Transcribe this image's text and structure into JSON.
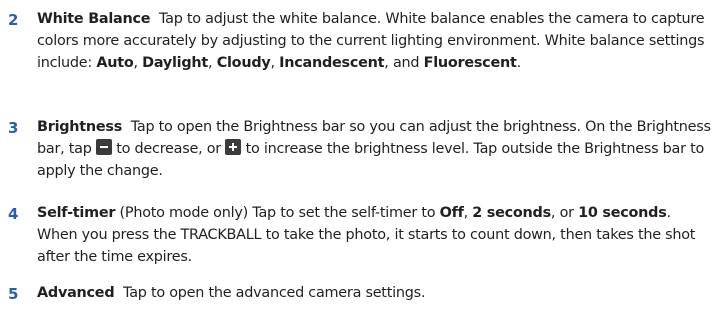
{
  "items": [
    {
      "number": "2",
      "title": "White Balance",
      "text_1": "Tap to adjust the white balance. White balance enables the camera to capture colors more accurately by adjusting to the current lighting environment. White balance settings include:",
      "opt_1": "Auto",
      "opt_2": "Daylight",
      "opt_3": "Cloudy",
      "opt_4": "Incandescent",
      "and": "and",
      "opt_5": "Fluorescent",
      "end": "."
    },
    {
      "number": "3",
      "title": "Brightness",
      "text_1": "Tap to open the Brightness bar so you can adjust the brightness. On the Brightness bar, tap",
      "minus_icon": "minus-icon",
      "text_2": "to decrease, or",
      "plus_icon": "plus-icon",
      "text_3": "to increase the brightness level. Tap outside the Brightness bar to apply the change."
    },
    {
      "number": "4",
      "title": "Self-timer",
      "text_1": "(Photo mode only) Tap to set the self-timer to",
      "opt_1": "Off",
      "opt_2": "2 seconds",
      "or": "or",
      "opt_3": "10 seconds",
      "text_2": ". When you press the TRACKBALL to take the photo, it starts to count down, then takes the shot after the time expires."
    },
    {
      "number": "5",
      "title": "Advanced",
      "text_1": "Tap to open the advanced camera settings."
    }
  ],
  "colors": {
    "number": "#2f5ea8",
    "text": "#231f20",
    "icon_button": "#3b3b3b"
  }
}
